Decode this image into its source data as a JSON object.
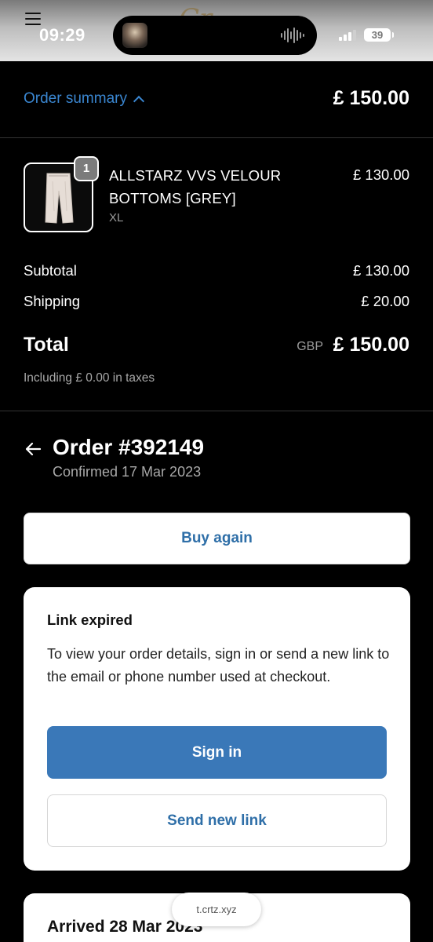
{
  "status_bar": {
    "time": "09:29",
    "battery": "39",
    "icons": [
      "menu-icon",
      "cellular-signal-icon",
      "battery-icon",
      "audio-waveform-icon"
    ]
  },
  "summary": {
    "toggle_label": "Order summary",
    "total": "£ 150.00"
  },
  "line_item": {
    "quantity": "1",
    "title": "ALLSTARZ VVS VELOUR BOTTOMS [GREY]",
    "variant": "XL",
    "price": "£ 130.00"
  },
  "costs": {
    "subtotal_label": "Subtotal",
    "subtotal_value": "£ 130.00",
    "shipping_label": "Shipping",
    "shipping_value": "£ 20.00",
    "total_label": "Total",
    "total_currency": "GBP",
    "total_value": "£ 150.00",
    "taxes_note": "Including £ 0.00 in taxes"
  },
  "order": {
    "title": "Order #392149",
    "confirmed": "Confirmed 17 Mar 2023"
  },
  "buy_again_label": "Buy again",
  "link_card": {
    "title": "Link expired",
    "text": "To view your order details, sign in or send a new link to the email or phone number used at checkout.",
    "sign_in_label": "Sign in",
    "send_link_label": "Send new link"
  },
  "delivery_card": {
    "title": "Arrived 28 Mar 2023"
  },
  "browser": {
    "url": "t.crtz.xyz"
  },
  "colors": {
    "accent_link": "#3a86d0",
    "primary_button": "#3a78b8",
    "background": "#000000"
  }
}
